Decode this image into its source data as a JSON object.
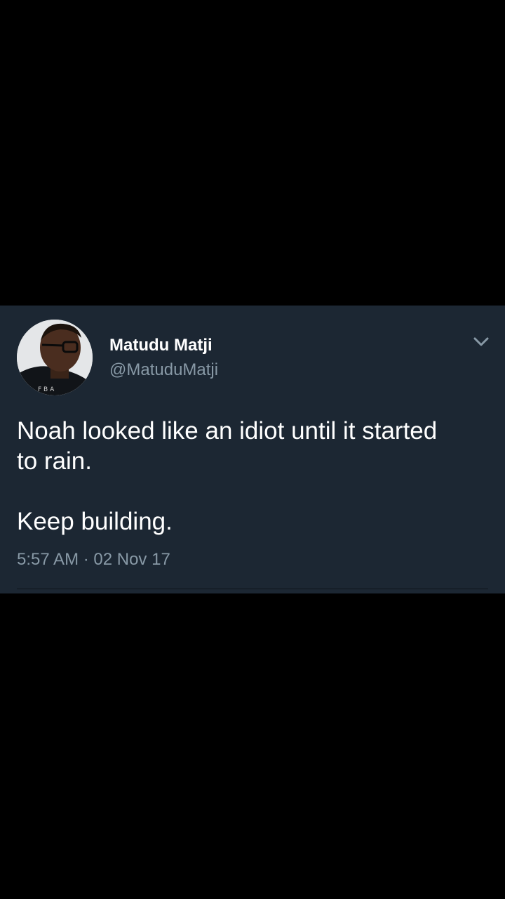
{
  "tweet": {
    "author_name": "Matudu Matji",
    "author_handle": "@MatuduMatji",
    "text": "Noah looked like an idiot until it started\nto rain.\n\nKeep building.",
    "timestamp": "5:57 AM · 02 Nov 17"
  },
  "icons": {
    "menu": "chevron-down-icon",
    "avatar": "profile-photo"
  },
  "colors": {
    "background": "#000000",
    "card": "#1c2733",
    "primary_text": "#ffffff",
    "secondary_text": "#8899a6"
  }
}
